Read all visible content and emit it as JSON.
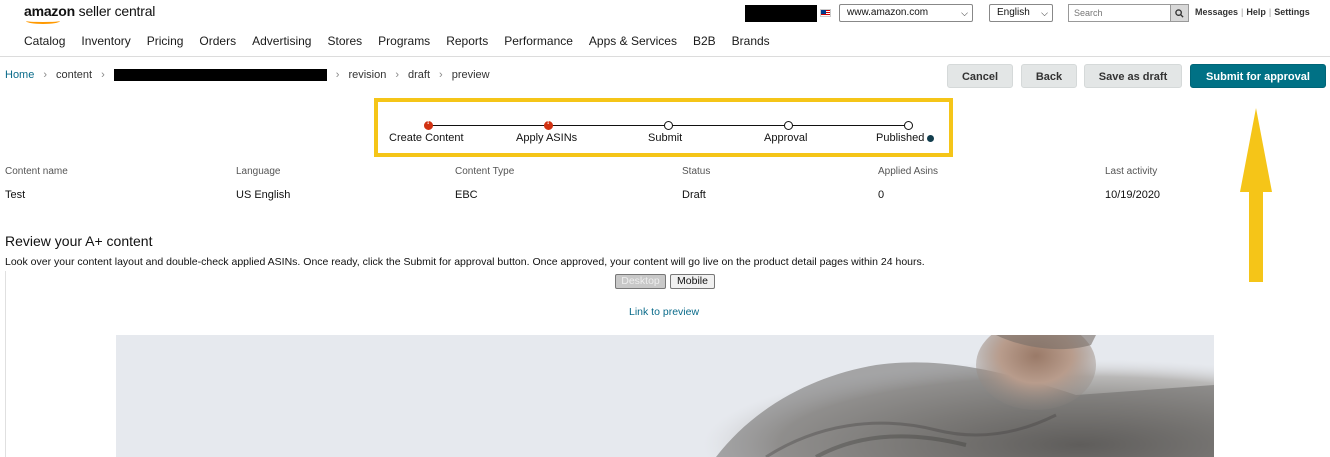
{
  "header": {
    "logo_brand": "amazon",
    "logo_product": "seller central",
    "marketplace": "www.amazon.com",
    "language": "English",
    "search_placeholder": "Search",
    "links": [
      "Messages",
      "Help",
      "Settings"
    ],
    "nav": [
      "Catalog",
      "Inventory",
      "Pricing",
      "Orders",
      "Advertising",
      "Stores",
      "Programs",
      "Reports",
      "Performance",
      "Apps & Services",
      "B2B",
      "Brands"
    ]
  },
  "breadcrumb": [
    "Home",
    "content",
    "revision",
    "draft",
    "preview"
  ],
  "actions": {
    "cancel": "Cancel",
    "back": "Back",
    "save_draft": "Save as draft",
    "submit": "Submit for approval"
  },
  "stepper": {
    "steps": [
      {
        "label": "Create Content",
        "state": "error"
      },
      {
        "label": "Apply ASINs",
        "state": "error"
      },
      {
        "label": "Submit",
        "state": "pending"
      },
      {
        "label": "Approval",
        "state": "pending"
      },
      {
        "label": "Published",
        "state": "pending"
      }
    ],
    "highlight_color": "#f5c518"
  },
  "details": {
    "labels": [
      "Content name",
      "Language",
      "Content Type",
      "Status",
      "Applied Asins",
      "Last activity"
    ],
    "values": [
      "Test",
      "US English",
      "EBC",
      "Draft",
      "0",
      "10/19/2020"
    ]
  },
  "review": {
    "title": "Review your A+ content",
    "description": "Look over your content layout and double-check applied ASINs. Once ready, click the Submit for approval button. Once approved, your content will go live on the product detail pages within 24 hours.",
    "toggle_desktop": "Desktop",
    "toggle_mobile": "Mobile",
    "preview_link": "Link to preview"
  },
  "colors": {
    "accent_teal": "#007185",
    "link": "#0a6b8a",
    "error": "#d13212",
    "annotation_yellow": "#f5c518"
  }
}
